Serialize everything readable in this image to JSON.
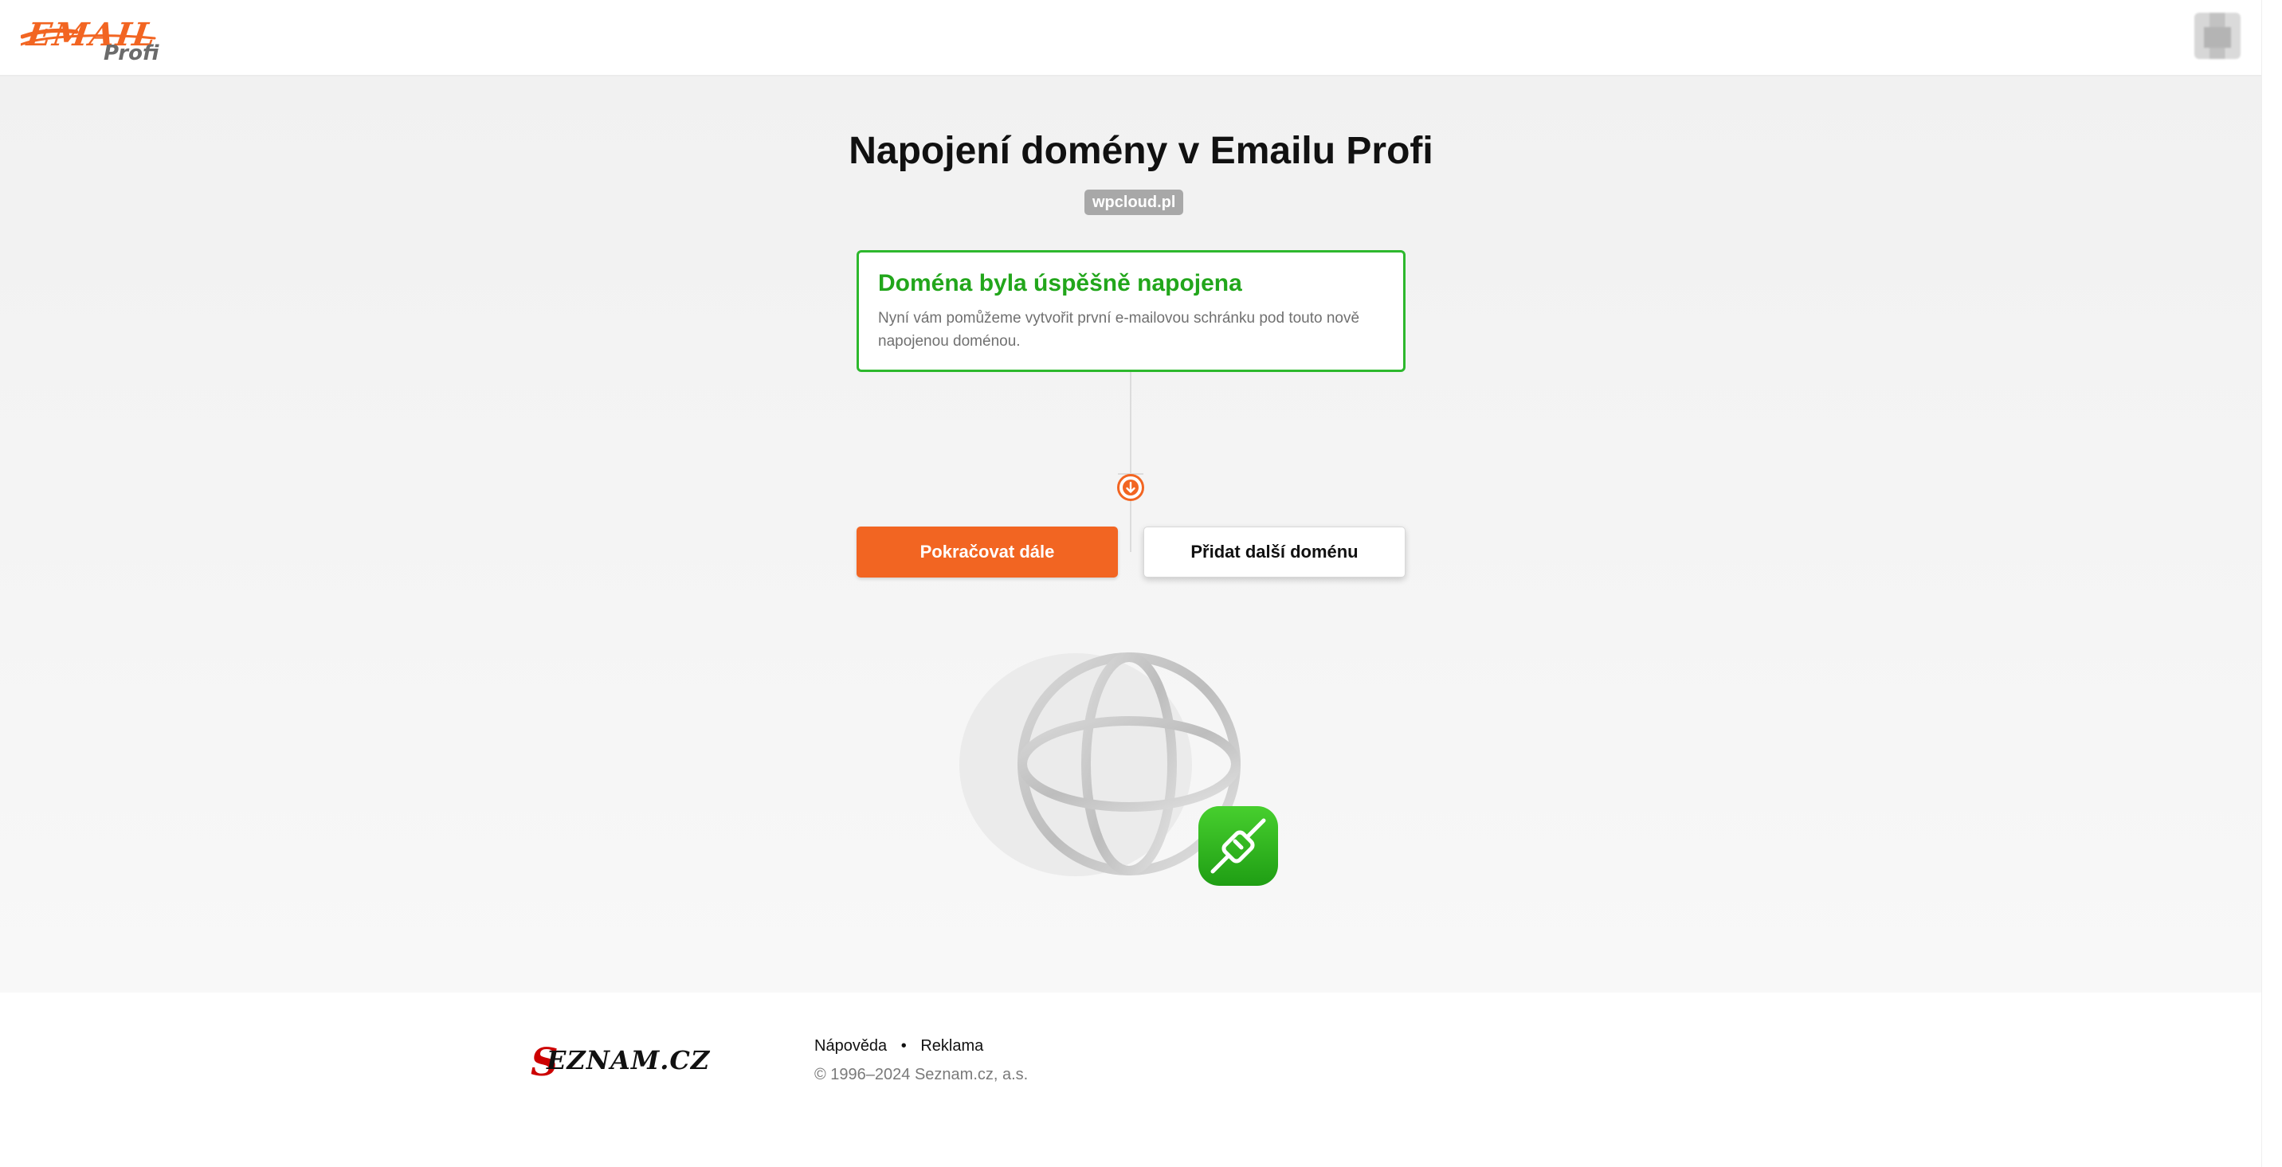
{
  "header": {
    "logo_word": "EMAIL",
    "logo_sub": "Profi"
  },
  "main": {
    "title": "Napojení domény v Emailu Profi",
    "domain": "wpcloud.pl",
    "success": {
      "title": "Doména byla úspěšně napojena",
      "text": "Nyní vám pomůžeme vytvořit první e-mailovou schránku pod touto nově napojenou doménou."
    },
    "buttons": {
      "continue": "Pokračovat dále",
      "add_domain": "Přidat další doménu"
    }
  },
  "footer": {
    "logo_s": "S",
    "logo_rest": "EZNAM.CZ",
    "links": [
      "Nápověda",
      "Reklama"
    ],
    "separator": "•",
    "copyright": "© 1996–2024 Seznam.cz, a.s."
  },
  "colors": {
    "brand": "#f26522",
    "success": "#22a61b",
    "link_green": "#2db82d"
  },
  "icons": {
    "arrow": "arrow-down-circle-icon",
    "globe": "globe-icon",
    "link": "link-icon"
  }
}
